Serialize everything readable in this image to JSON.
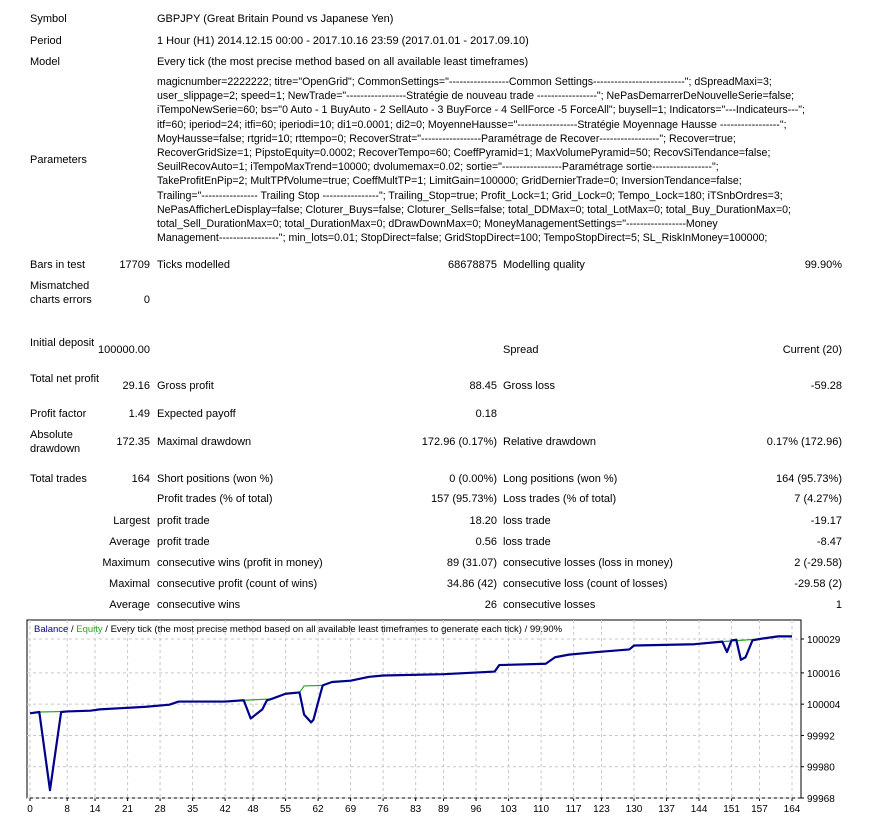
{
  "header": {
    "symbol_label": "Symbol",
    "symbol": "GBPJPY (Great Britain Pound vs Japanese Yen)",
    "period_label": "Period",
    "period": "1 Hour (H1) 2014.12.15 00:00 - 2017.10.16 23:59 (2017.01.01 - 2017.09.10)",
    "model_label": "Model",
    "model": "Every tick (the most precise method based on all available least timeframes)",
    "parameters_label": "Parameters",
    "parameters_lines": [
      "magicnumber=2222222; titre=\"OpenGrid\"; CommonSettings=\"-----------------Common Settings--------------------------\"; dSpreadMaxi=3;",
      "user_slippage=2; speed=1; NewTrade=\"-----------------Stratégie de nouveau trade -----------------\"; NePasDemarrerDeNouvelleSerie=false;",
      "iTempoNewSerie=60; bs=\"0 Auto - 1 BuyAuto - 2 SellAuto - 3 BuyForce - 4 SellForce -5 ForceAll\"; buysell=1; Indicators=\"---Indicateurs---\";",
      "itf=60; iperiod=24; itfi=60; iperiodi=10; di1=0.0001; di2=0; MoyenneHausse=\"-----------------Stratégie Moyennage Hausse -----------------\";",
      "MoyHausse=false; rtgrid=10; rttempo=0; RecoverStrat=\"-----------------Paramétrage de Recover-----------------\"; Recover=true;",
      "RecoverGridSize=1; PipstoEquity=0.0002; RecoverTempo=60; CoeffPyramid=1; MaxVolumePyramid=50; RecovSiTendance=false;",
      "SeuilRecovAuto=1; iTempoMaxTrend=10000; dvolumemax=0.02; sortie=\"-----------------Paramétrage sortie-----------------\";",
      "TakeProfitEnPip=2; MultTPfVolume=true; CoeffMultTP=1; LimitGain=100000; GridDernierTrade=0; InversionTendance=false;",
      "Trailing=\"---------------- Trailing Stop ----------------\"; Trailing_Stop=true; Profit_Lock=1; Grid_Lock=0; Tempo_Lock=180; iTSnbOrdres=3;",
      "NePasAfficherLeDisplay=false; Cloturer_Buys=false; Cloturer_Sells=false; total_DDMax=0; total_LotMax=0; total_Buy_DurationMax=0;",
      "total_Sell_DurationMax=0; total_DurationMax=0; dDrawDownMax=0; MoneyManagementSettings=\"-----------------Money",
      "Management-----------------\"; min_lots=0.01; StopDirect=false; GridStopDirect=100; TempoStopDirect=5; SL_RiskInMoney=100000;"
    ]
  },
  "stats": [
    [
      "Bars in test",
      "17709",
      "Ticks modelled",
      "68678875",
      "Modelling quality",
      "99.90%"
    ],
    [
      "Mismatched charts errors",
      "0",
      "",
      "",
      "",
      ""
    ],
    [
      "Initial deposit",
      "100000.00",
      "",
      "",
      "Spread",
      "Current (20)"
    ],
    [
      "Total net profit",
      "29.16",
      "Gross profit",
      "88.45",
      "Gross loss",
      "-59.28"
    ],
    [
      "Profit factor",
      "1.49",
      "Expected payoff",
      "0.18",
      "",
      ""
    ],
    [
      "Absolute drawdown",
      "172.35",
      "Maximal drawdown",
      "172.96 (0.17%)",
      "Relative drawdown",
      "0.17% (172.96)"
    ],
    [
      "Total trades",
      "164",
      "Short positions (won %)",
      "0 (0.00%)",
      "Long positions (won %)",
      "164 (95.73%)"
    ],
    [
      "",
      "",
      "Profit trades (% of total)",
      "157 (95.73%)",
      "Loss trades (% of total)",
      "7 (4.27%)"
    ],
    [
      "",
      "Largest",
      "profit trade",
      "18.20",
      "loss trade",
      "-19.17"
    ],
    [
      "",
      "Average",
      "profit trade",
      "0.56",
      "loss trade",
      "-8.47"
    ],
    [
      "",
      "Maximum",
      "consecutive wins (profit in money)",
      "89 (31.07)",
      "consecutive losses (loss in money)",
      "2 (-29.58)"
    ],
    [
      "",
      "Maximal",
      "consecutive profit (count of wins)",
      "34.86 (42)",
      "consecutive loss (count of losses)",
      "-29.58 (2)"
    ],
    [
      "",
      "Average",
      "consecutive wins",
      "26",
      "consecutive losses",
      "1"
    ]
  ],
  "chart_data": {
    "type": "line",
    "title_parts": [
      "Balance",
      " / ",
      "Equity",
      " / Every tick (the most precise method based on all available least timeframes to generate each tick) / 99.90%"
    ],
    "colors": {
      "balance": "#00008b",
      "equity": "#22aa22"
    },
    "x_ticks": [
      0,
      8,
      14,
      21,
      28,
      35,
      42,
      48,
      55,
      62,
      69,
      76,
      83,
      89,
      96,
      103,
      110,
      117,
      123,
      130,
      137,
      144,
      151,
      157,
      164
    ],
    "y_ticks": [
      100029,
      100016,
      100004,
      99992,
      99980,
      99968
    ],
    "xlim": [
      0,
      164
    ],
    "ylim": [
      99968,
      100029
    ],
    "grid": true,
    "series": [
      {
        "name": "Equity",
        "points": [
          [
            0,
            100000.5
          ],
          [
            2,
            100001
          ],
          [
            8,
            100001.2
          ],
          [
            13,
            100001.5
          ],
          [
            15,
            100002
          ],
          [
            20,
            100002.5
          ],
          [
            25,
            100003
          ],
          [
            30,
            100003.8
          ],
          [
            32,
            100005
          ],
          [
            42,
            100005
          ],
          [
            46,
            100005.5
          ],
          [
            52,
            100006
          ],
          [
            55,
            100008
          ],
          [
            58,
            100008.5
          ],
          [
            59,
            100011
          ],
          [
            63,
            100011.2
          ],
          [
            65,
            100012.5
          ],
          [
            69,
            100013
          ],
          [
            73,
            100014.5
          ],
          [
            76,
            100015
          ],
          [
            89,
            100015.5
          ],
          [
            100,
            100016.5
          ],
          [
            101,
            100019
          ],
          [
            111,
            100019.5
          ],
          [
            113,
            100022
          ],
          [
            116,
            100023
          ],
          [
            122,
            100024
          ],
          [
            129,
            100025
          ],
          [
            130,
            100026.5
          ],
          [
            143,
            100027
          ],
          [
            149,
            100028
          ],
          [
            157,
            100029
          ],
          [
            161,
            100030
          ],
          [
            164,
            100030
          ]
        ]
      },
      {
        "name": "Balance",
        "points": [
          [
            0,
            100000.5
          ],
          [
            2,
            100001
          ],
          [
            4.3,
            99971
          ],
          [
            6.7,
            100001
          ],
          [
            8,
            100001.2
          ],
          [
            13,
            100001.5
          ],
          [
            15,
            100002
          ],
          [
            20,
            100002.5
          ],
          [
            25,
            100003
          ],
          [
            30,
            100003.8
          ],
          [
            32,
            100005
          ],
          [
            42,
            100005
          ],
          [
            46,
            100005.5
          ],
          [
            47.5,
            99998.5
          ],
          [
            50,
            100002
          ],
          [
            51,
            100005.5
          ],
          [
            52,
            100006
          ],
          [
            55,
            100008
          ],
          [
            58,
            100008.5
          ],
          [
            59,
            100000
          ],
          [
            60.5,
            99997
          ],
          [
            61,
            99998
          ],
          [
            62.5,
            100008
          ],
          [
            63,
            100011.2
          ],
          [
            65,
            100012.5
          ],
          [
            69,
            100013
          ],
          [
            73,
            100014.5
          ],
          [
            76,
            100015
          ],
          [
            89,
            100015.5
          ],
          [
            100,
            100016.5
          ],
          [
            101,
            100019
          ],
          [
            111,
            100019.5
          ],
          [
            113,
            100022
          ],
          [
            116,
            100023
          ],
          [
            122,
            100024
          ],
          [
            129,
            100025
          ],
          [
            130,
            100026.5
          ],
          [
            143,
            100027
          ],
          [
            149,
            100028
          ],
          [
            150,
            100024
          ],
          [
            151,
            100028.5
          ],
          [
            152,
            100028.7
          ],
          [
            153,
            100021
          ],
          [
            154,
            100022
          ],
          [
            155.5,
            100028.5
          ],
          [
            157,
            100029
          ],
          [
            161,
            100030
          ],
          [
            164,
            100030
          ]
        ]
      }
    ]
  }
}
